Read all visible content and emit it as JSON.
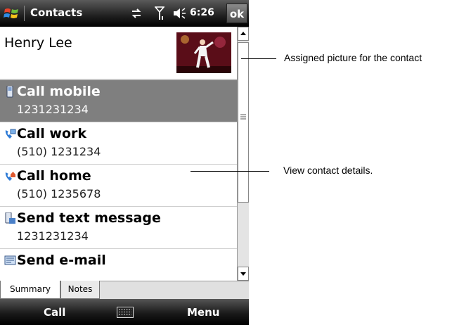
{
  "statusbar": {
    "title": "Contacts",
    "time": "6:26",
    "ok_label": "ok",
    "icons": [
      "windows-start-icon",
      "sync-arrows-icon",
      "signal-icon",
      "speaker-icon"
    ]
  },
  "contact": {
    "name": "Henry Lee"
  },
  "items": [
    {
      "icon": "mobile-phone-icon",
      "label": "Call mobile",
      "value": "1231231234",
      "selected": true
    },
    {
      "icon": "work-phone-icon",
      "label": "Call work",
      "value": "(510) 1231234",
      "selected": false
    },
    {
      "icon": "home-phone-icon",
      "label": "Call home",
      "value": "(510) 1235678",
      "selected": false
    },
    {
      "icon": "text-message-icon",
      "label": "Send text message",
      "value": "1231231234",
      "selected": false
    },
    {
      "icon": "email-icon",
      "label": "Send e-mail",
      "value": "",
      "selected": false
    }
  ],
  "tabs": [
    {
      "label": "Summary",
      "active": true
    },
    {
      "label": "Notes",
      "active": false
    }
  ],
  "softkeys": {
    "left": "Call",
    "right": "Menu",
    "center_icon": "keyboard-icon"
  },
  "annotations": {
    "picture": "Assigned picture for the contact",
    "details": "View contact details."
  },
  "colors": {
    "selected_row": "#7f7f7f",
    "bar_dark": "#000000"
  }
}
